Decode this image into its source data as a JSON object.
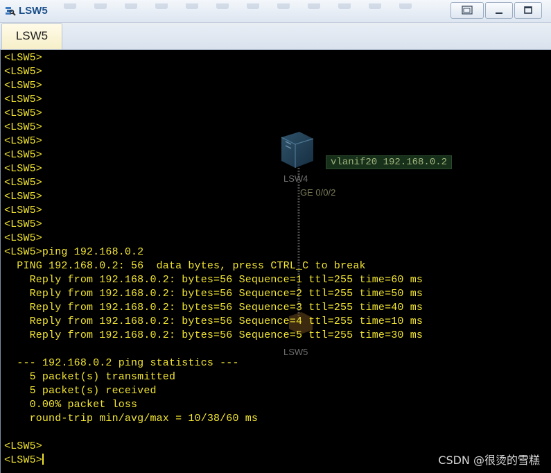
{
  "window": {
    "title": "LSW5",
    "app_icon": "ensp-switch-icon",
    "controls": [
      "restore-icon",
      "minimize-icon",
      "maximize-icon"
    ]
  },
  "tabs": [
    {
      "label": "LSW5",
      "active": true
    }
  ],
  "terminal": {
    "text_color": "#f2e530",
    "background": "#000000",
    "prompt": "<LSW5>",
    "lines": [
      "<LSW5>",
      "<LSW5>",
      "<LSW5>",
      "<LSW5>",
      "<LSW5>",
      "<LSW5>",
      "<LSW5>",
      "<LSW5>",
      "<LSW5>",
      "<LSW5>",
      "<LSW5>",
      "<LSW5>",
      "<LSW5>",
      "<LSW5>",
      "<LSW5>ping 192.168.0.2",
      "  PING 192.168.0.2: 56  data bytes, press CTRL_C to break",
      "    Reply from 192.168.0.2: bytes=56 Sequence=1 ttl=255 time=60 ms",
      "    Reply from 192.168.0.2: bytes=56 Sequence=2 ttl=255 time=50 ms",
      "    Reply from 192.168.0.2: bytes=56 Sequence=3 ttl=255 time=40 ms",
      "    Reply from 192.168.0.2: bytes=56 Sequence=4 ttl=255 time=10 ms",
      "    Reply from 192.168.0.2: bytes=56 Sequence=5 ttl=255 time=30 ms",
      "",
      "  --- 192.168.0.2 ping statistics ---",
      "    5 packet(s) transmitted",
      "    5 packet(s) received",
      "    0.00% packet loss",
      "    round-trip min/avg/max = 10/38/60 ms",
      "",
      "<LSW5>",
      "<LSW5>"
    ]
  },
  "background_topology": {
    "switch_top_label": "LSW4",
    "port_label": "GE 0/0/2",
    "vlanif_tag": "vlanif20 192.168.0.2",
    "switch_bottom_label": "LSW5",
    "switch_icon": "network-switch-icon"
  },
  "watermark": "CSDN @很烫的雪糕"
}
